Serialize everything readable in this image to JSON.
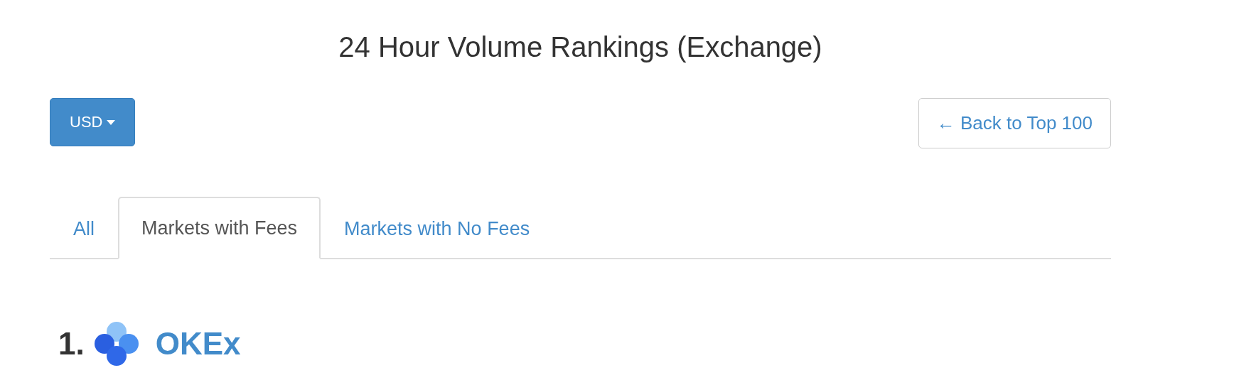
{
  "title": "24 Hour Volume Rankings (Exchange)",
  "currency_button": {
    "label": "USD"
  },
  "back_button": {
    "label": "← Back to Top 100"
  },
  "tabs": [
    {
      "label": "All",
      "selected": false
    },
    {
      "label": "Markets with Fees",
      "selected": true
    },
    {
      "label": "Markets with No Fees",
      "selected": false
    }
  ],
  "rankings": [
    {
      "rank": "1.",
      "name": "OKEx"
    }
  ]
}
